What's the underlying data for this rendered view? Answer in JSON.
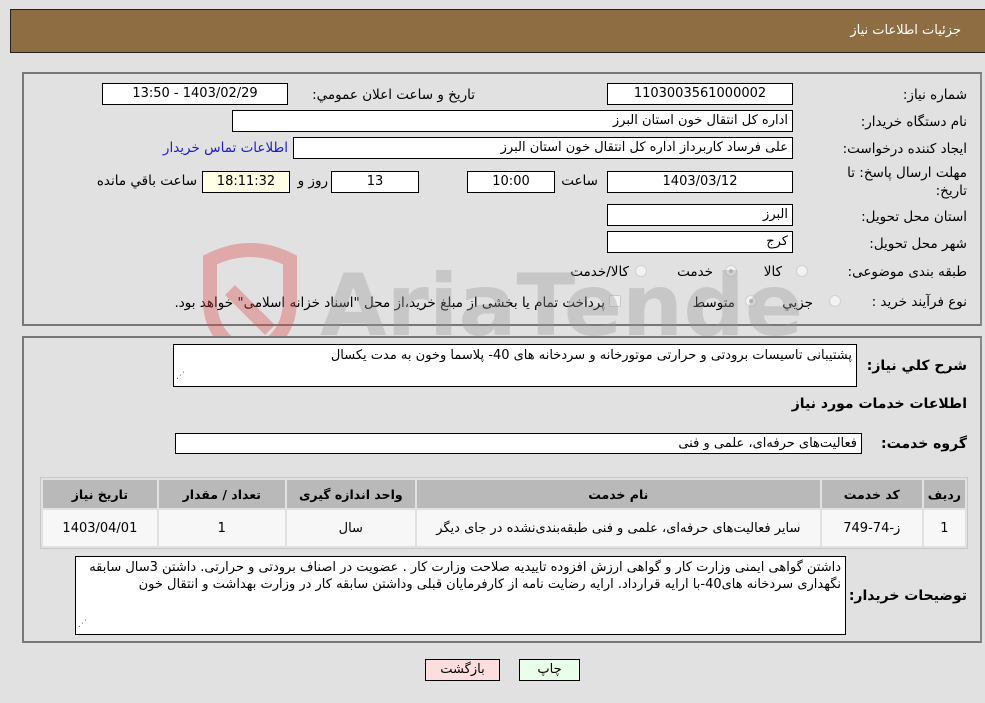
{
  "header": {
    "title": "جزئیات اطلاعات نیاز"
  },
  "form": {
    "need_number": {
      "label": "شماره نیاز:",
      "value": "1103003561000002"
    },
    "announce_datetime": {
      "label": "تاریخ و ساعت اعلان عمومي:",
      "value": "1403/02/29 - 13:50"
    },
    "buyer_org": {
      "label": "نام دستگاه خریدار:",
      "value": "اداره کل انتقال خون استان البرز"
    },
    "requester": {
      "label": "ایجاد کننده درخواست:",
      "value": "علی  فرساد کاربرداز اداره کل انتقال خون استان البرز"
    },
    "buyer_contact_link": "اطلاعات تماس خریدار",
    "deadline": {
      "label_line1": "مهلت ارسال پاسخ: تا",
      "label_line2": "تاریخ:",
      "date": "1403/03/12",
      "time_label": "ساعت",
      "time": "10:00",
      "days": "13",
      "days_label": "روز و",
      "remaining": "18:11:32",
      "remaining_label": "ساعت باقي مانده"
    },
    "delivery_province": {
      "label": "استان محل تحویل:",
      "value": "البرز"
    },
    "delivery_city": {
      "label": "شهر محل تحویل:",
      "value": "کرج"
    },
    "category": {
      "label": "طبقه بندی موضوعی:",
      "options": [
        "کالا",
        "خدمت",
        "کالا/خدمت"
      ],
      "selected": "خدمت"
    },
    "purchase_type": {
      "label": "نوع فرآیند خرید :",
      "options": [
        "جزيي",
        "متوسط"
      ],
      "selected": "متوسط",
      "treasury_note": "پرداخت تمام یا بخشی از مبلغ خرید،از محل \"اسناد خزانه اسلامی\" خواهد بود."
    }
  },
  "details": {
    "description_label": "شرح کلي نیاز:",
    "description": "پشتیبانی تاسیسات برودتی و حرارتی موتورخانه و سردخانه های 40- پلاسما وخون به مدت یکسال",
    "services_heading": "اطلاعات خدمات مورد نیاز",
    "service_group_label": "گروه خدمت:",
    "service_group": "فعالیت‌های حرفه‌ای، علمی و فنی",
    "table": {
      "headers": [
        "ردیف",
        "کد خدمت",
        "نام خدمت",
        "واحد اندازه گیری",
        "تعداد / مقدار",
        "تاریخ نیاز"
      ],
      "rows": [
        [
          "1",
          "ز-74-749",
          "سایر فعالیت‌های حرفه‌ای، علمی و فنی طبقه‌بندی‌نشده در جای دیگر",
          "سال",
          "1",
          "1403/04/01"
        ]
      ]
    },
    "buyer_notes_label": "توضیحات خریدار:",
    "buyer_notes": "داشتن گواهی ایمنی وزارت کار و گواهی ارزش افزوده تاییدیه صلاحت وزارت کار . عضویت در اصناف برودتی و حرارتی. داشتن 3سال سابقه نگهداری سردخانه های40-با ارایه قرارداد. ارایه رضایت نامه از کارفرمایان قبلی وداشتن سابقه کار در وزارت بهداشت و انتقال خون"
  },
  "buttons": {
    "print": "چاپ",
    "back": "بازگشت"
  },
  "watermark": "AriaTender.neT"
}
